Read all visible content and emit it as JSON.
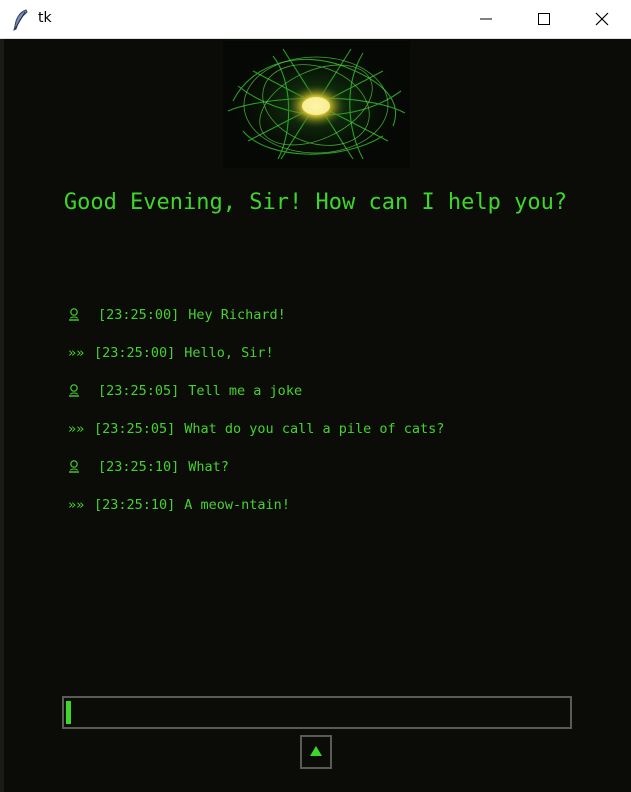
{
  "window": {
    "title": "tk"
  },
  "greeting": "Good Evening, Sir! How can I help you?",
  "colors": {
    "accent": "#3fd62a",
    "background": "#0b0b08",
    "border": "#5a5a56"
  },
  "messages": [
    {
      "role": "user",
      "time": "[23:25:00]",
      "text": "Hey Richard!"
    },
    {
      "role": "assistant",
      "prefix": "»»",
      "time": "[23:25:00]",
      "text": "Hello, Sir!"
    },
    {
      "role": "user",
      "time": "[23:25:05]",
      "text": "Tell me a joke"
    },
    {
      "role": "assistant",
      "prefix": "»»",
      "time": "[23:25:05]",
      "text": "What do you call a pile of cats?"
    },
    {
      "role": "user",
      "time": "[23:25:10]",
      "text": "What?"
    },
    {
      "role": "assistant",
      "prefix": "»»",
      "time": "[23:25:10]",
      "text": "A meow-ntain!"
    }
  ],
  "input": {
    "value": ""
  },
  "icons": {
    "app": "tk-feather-icon",
    "user": "user-icon",
    "send": "triangle-up-icon"
  }
}
